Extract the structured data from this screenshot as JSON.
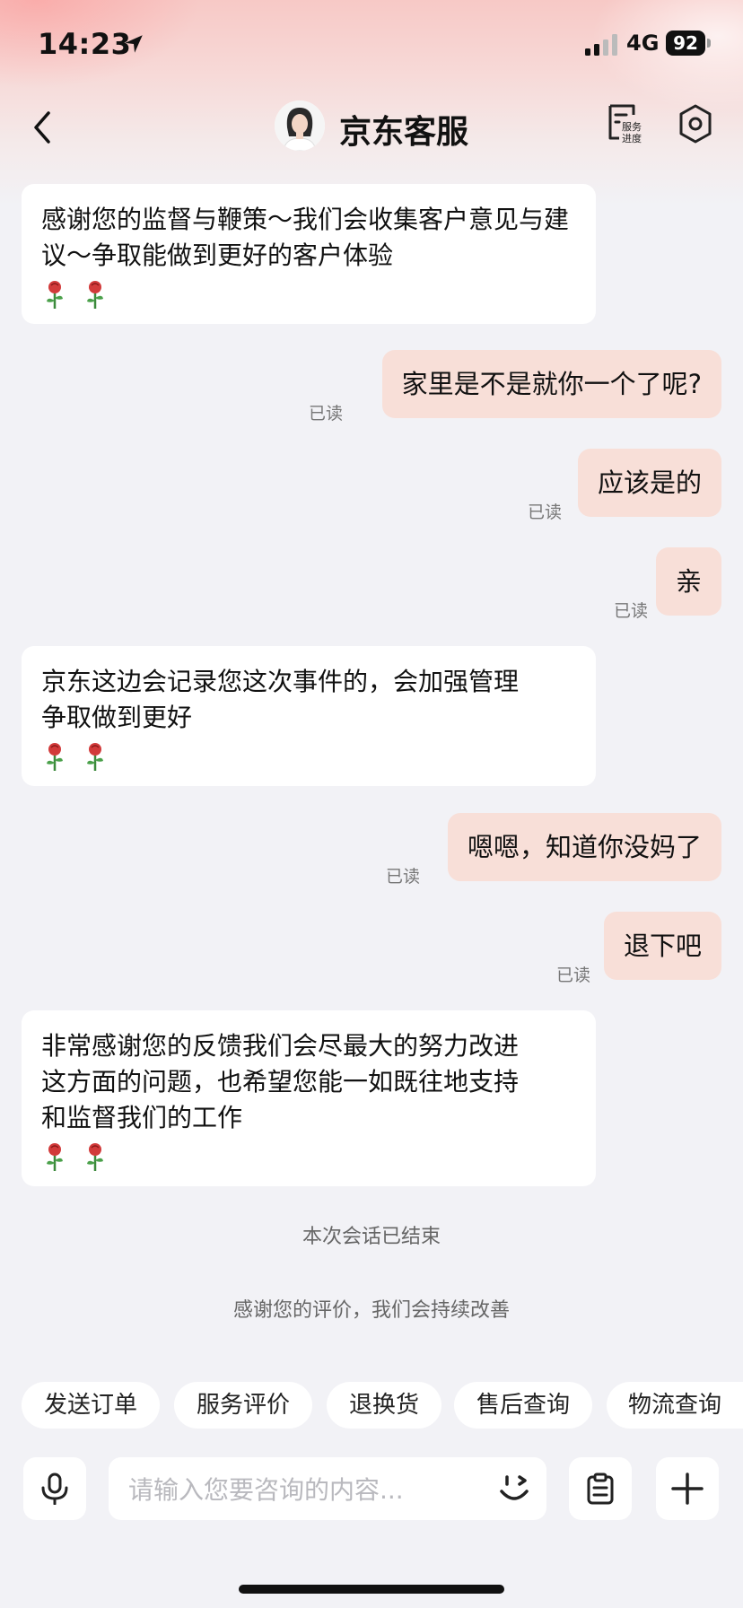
{
  "status_bar": {
    "time": "14:23",
    "network": "4G",
    "battery": "92"
  },
  "header": {
    "title": "京东客服",
    "progress_label_line1": "服务",
    "progress_label_line2": "进度"
  },
  "messages": [
    {
      "side": "left",
      "text": "感谢您的监督与鞭策～我们会收集客户意见与建议～争取能做到更好的客户体验",
      "roses": true
    },
    {
      "side": "right",
      "text": "家里是不是就你一个了呢?",
      "status": "已读"
    },
    {
      "side": "right",
      "text": "应该是的",
      "status": "已读"
    },
    {
      "side": "right",
      "text": "亲",
      "status": "已读"
    },
    {
      "side": "left",
      "text": "京东这边会记录您这次事件的，会加强管理争取做到更好",
      "roses": true
    },
    {
      "side": "right",
      "text": "嗯嗯，知道你没妈了",
      "status": "已读"
    },
    {
      "side": "right",
      "text": "退下吧",
      "status": "已读"
    },
    {
      "side": "left",
      "text": "非常感谢您的反馈我们会尽最大的努力改进这方面的问题，也希望您能一如既往地支持和监督我们的工作",
      "roses": true
    }
  ],
  "system_notices": {
    "session_ended": "本次会话已结束",
    "thanks_rating": "感谢您的评价，我们会持续改善"
  },
  "quick_actions": [
    "发送订单",
    "服务评价",
    "退换货",
    "售后查询",
    "物流查询"
  ],
  "input": {
    "placeholder": "请输入您要咨询的内容...",
    "value": ""
  },
  "icons": {
    "location": "location-arrow-icon",
    "back": "chevron-left-icon",
    "progress": "service-progress-icon",
    "settings": "settings-hexagon-icon",
    "voice": "microphone-icon",
    "emoji": "emoji-wink-icon",
    "clipboard": "clipboard-icon",
    "more": "plus-icon",
    "rose": "rose-emoji"
  },
  "colors": {
    "right_bubble": "#f8dfd8",
    "left_bubble": "#ffffff",
    "background": "#f2f2f6"
  }
}
